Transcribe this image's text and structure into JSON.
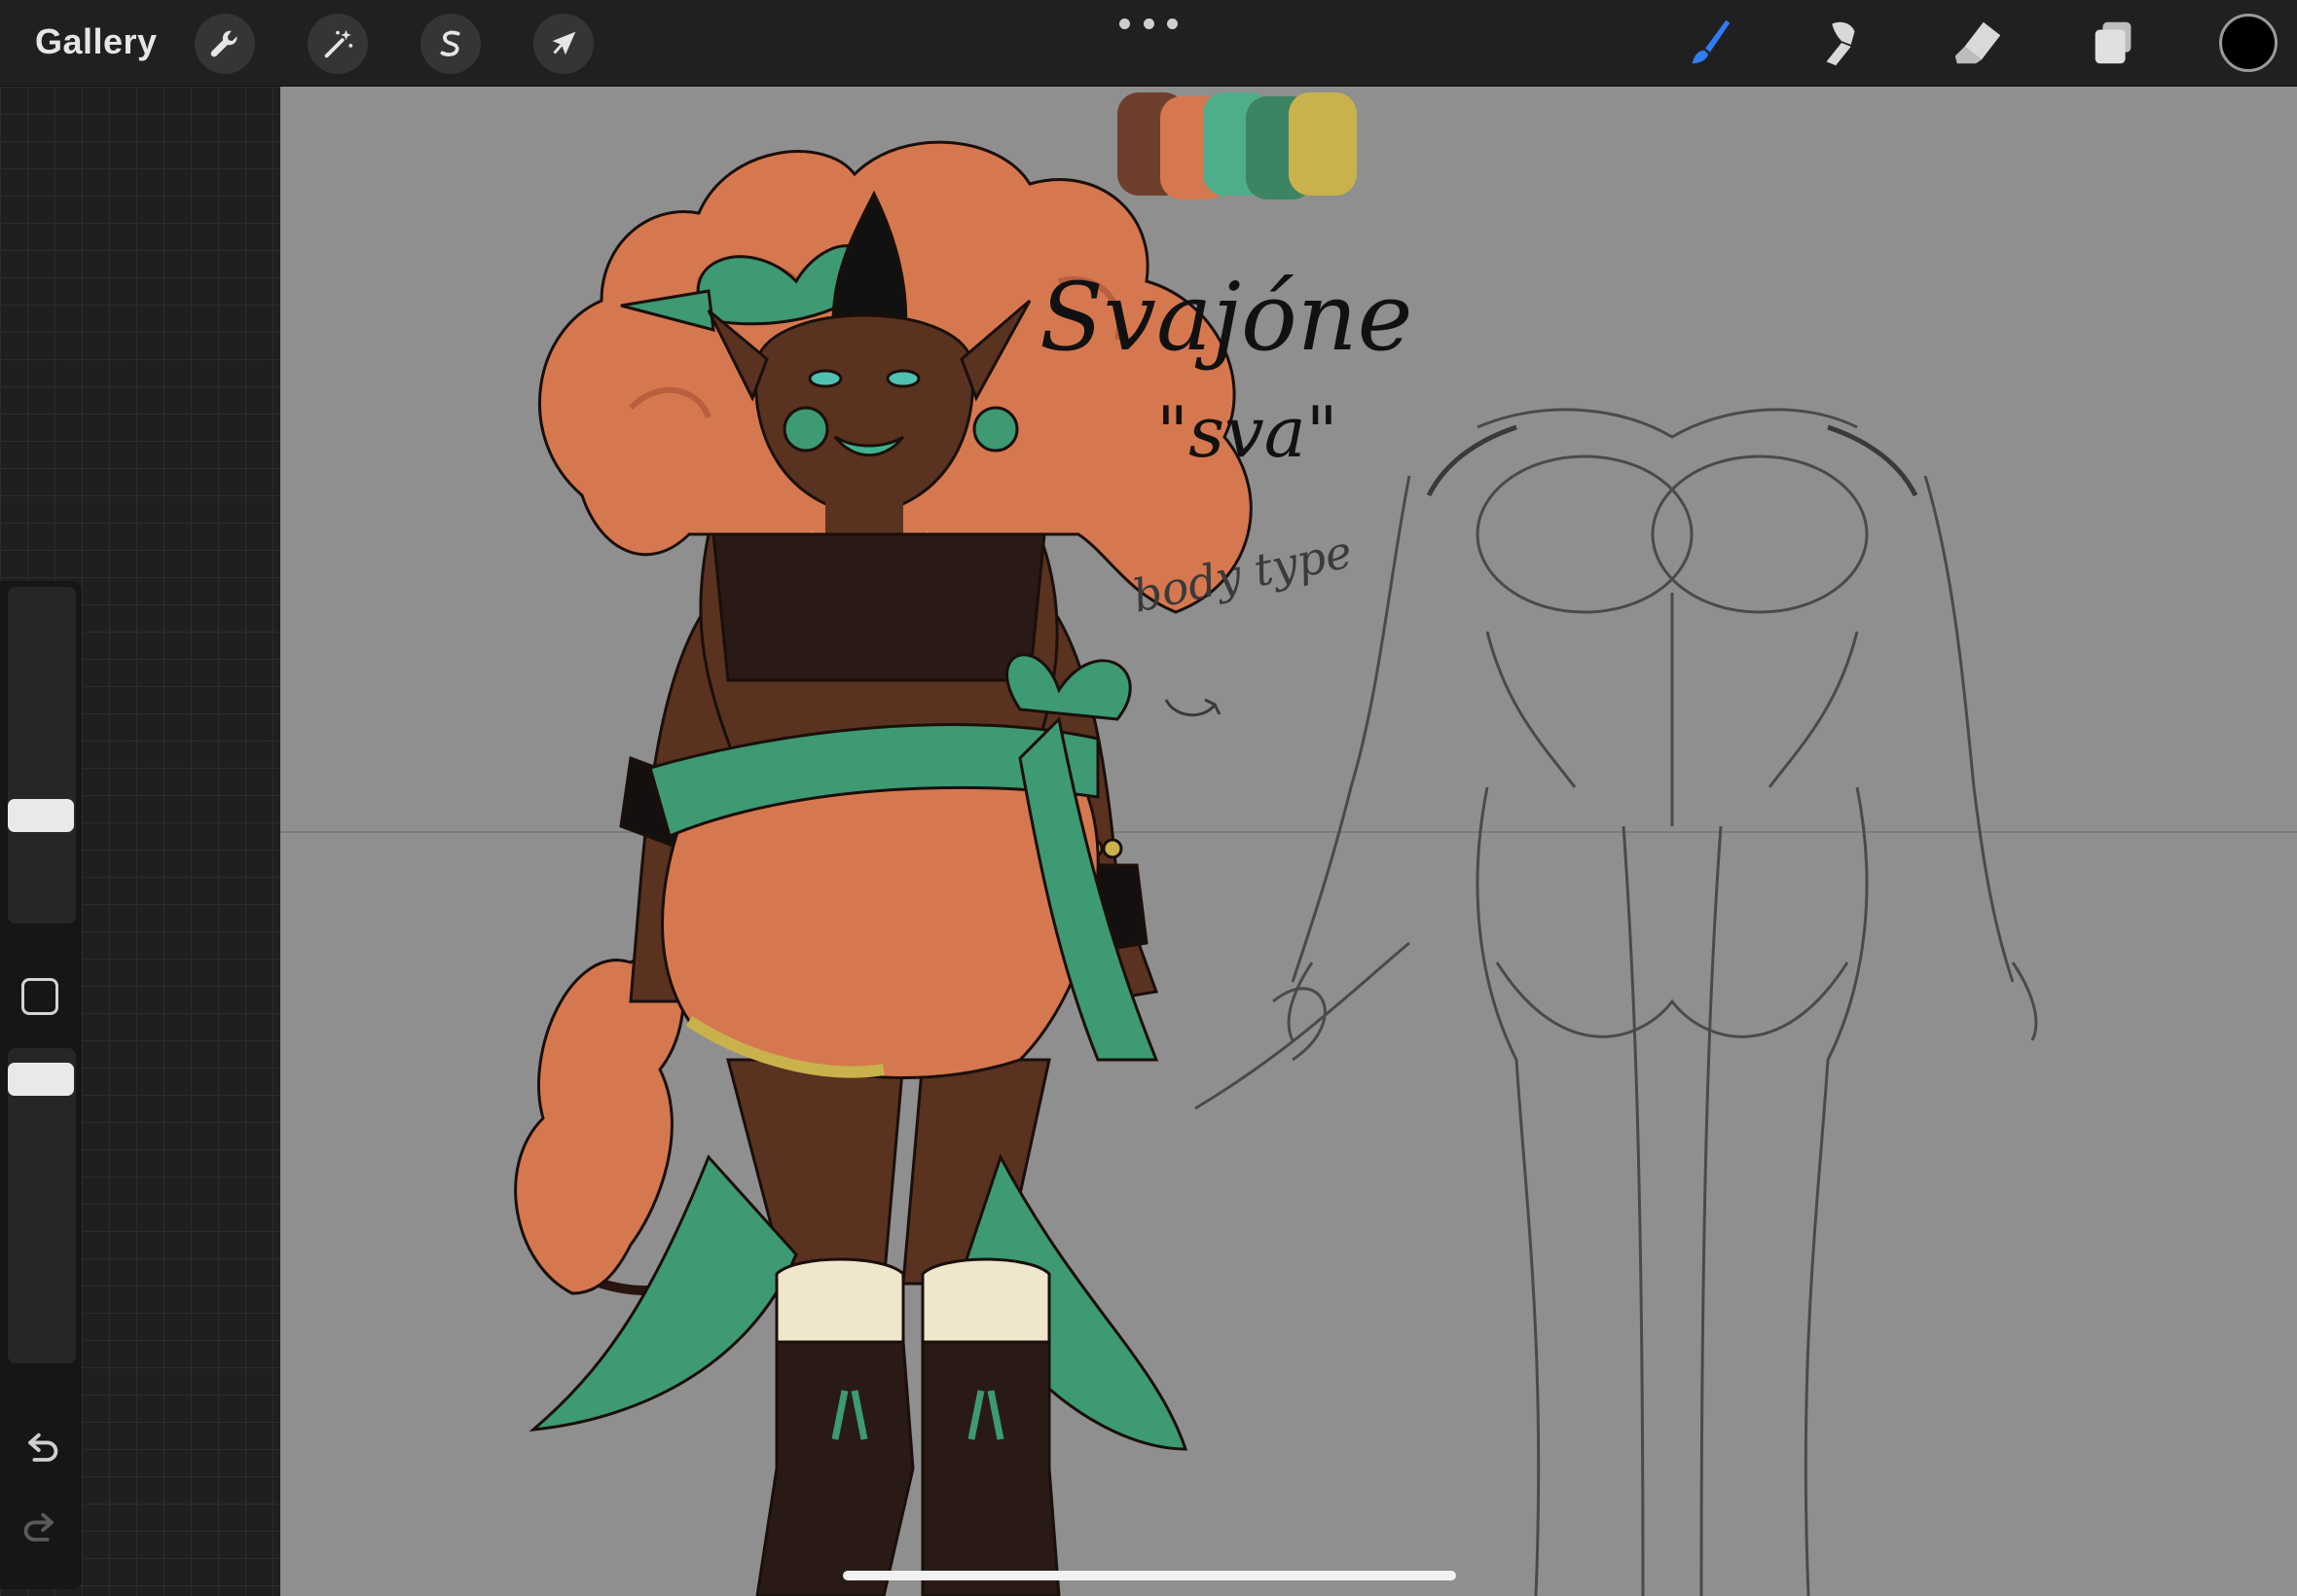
{
  "toolbar": {
    "gallery_label": "Gallery",
    "left_tools": [
      {
        "name": "actions",
        "icon": "wrench-icon"
      },
      {
        "name": "adjustments",
        "icon": "magic-wand-icon"
      },
      {
        "name": "selection",
        "icon": "selection-s-icon"
      },
      {
        "name": "transform",
        "icon": "arrow-cursor-icon"
      }
    ],
    "right_tools": [
      {
        "name": "brush",
        "icon": "brush-icon",
        "active": true
      },
      {
        "name": "smudge",
        "icon": "smudge-icon"
      },
      {
        "name": "eraser",
        "icon": "eraser-icon"
      },
      {
        "name": "layers",
        "icon": "layers-icon"
      }
    ],
    "current_color": "#000000",
    "active_color": "#2f7cf6"
  },
  "sidebar": {
    "brush_size_level": 0.3,
    "opacity_level": 0.95,
    "modify_icon": "square-modify-icon",
    "undo_icon": "undo-icon",
    "redo_icon": "redo-icon"
  },
  "canvas": {
    "background": "#8f8f8f",
    "palette": [
      "#6e3f2c",
      "#d6784f",
      "#4fae8a",
      "#3d8463",
      "#c9b24c"
    ],
    "character_name": "Svajóne",
    "nickname": "\"sva\"",
    "note": "body type"
  }
}
